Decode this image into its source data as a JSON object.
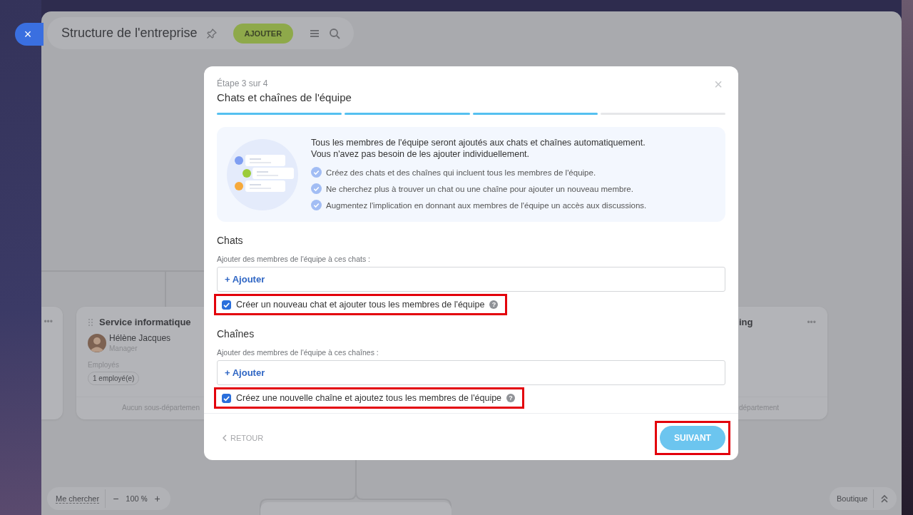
{
  "close_button": {
    "label": "×"
  },
  "header": {
    "title": "Structure de l'entreprise",
    "add_button": "AJOUTER"
  },
  "org_chart": {
    "departments": [
      {
        "kind": "edge",
        "menu": "•••"
      },
      {
        "kind": "full",
        "title": "Service informatique",
        "head": {
          "name": "Hélène Jacques",
          "role": "Manager"
        },
        "employees_label": "Employés",
        "employees_count": "1 employé(e)",
        "footer": "Aucun sous-départemen"
      },
      {
        "kind": "cut",
        "title": "ing",
        "menu": "•••",
        "footer": "département"
      }
    ]
  },
  "zoom_bar": {
    "find_me": "Me chercher",
    "zoom_out": "−",
    "zoom_value": "100",
    "zoom_unit": "%",
    "zoom_in": "+"
  },
  "shop_bar": {
    "label": "Boutique"
  },
  "dialog": {
    "step": "Étape 3 sur 4",
    "title": "Chats et chaînes de l'équipe",
    "close": "×",
    "progress": [
      {
        "done": true
      },
      {
        "done": true
      },
      {
        "done": true
      },
      {
        "done": false
      }
    ],
    "info": {
      "intro": [
        "Tous les membres de l'équipe seront ajoutés aux chats et chaînes automatiquement.",
        "Vous n'avez pas besoin de les ajouter individuellement."
      ],
      "benefits": [
        "Créez des chats et des chaînes qui incluent tous les membres de l'équipe.",
        "Ne cherchez plus à trouver un chat ou une chaîne pour ajouter un nouveau membre.",
        "Augmentez l'implication en donnant aux membres de l'équipe un accès aux discussions."
      ]
    },
    "sections": [
      {
        "heading": "Chats",
        "label": "Ajouter des membres de l'équipe à ces chats :",
        "add": "+ Ajouter",
        "checkbox": {
          "label": "Créer un nouveau chat et ajouter tous les membres de l'équipe",
          "help": "?",
          "checked": true,
          "highlighted": true
        }
      },
      {
        "heading": "Chaînes",
        "label": "Ajouter des membres de l'équipe à ces chaînes :",
        "add": "+ Ajouter",
        "checkbox": {
          "label": "Créez une nouvelle chaîne et ajoutez tous les membres de l'équipe",
          "help": "?",
          "checked": true,
          "highlighted": true
        }
      }
    ],
    "back_button": "RETOUR",
    "next_button": {
      "label": "SUIVANT",
      "highlighted": true
    }
  }
}
